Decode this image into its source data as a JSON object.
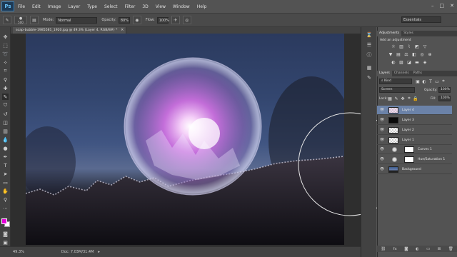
{
  "app": {
    "logo": "Ps",
    "menu": [
      "File",
      "Edit",
      "Image",
      "Layer",
      "Type",
      "Select",
      "Filter",
      "3D",
      "View",
      "Window",
      "Help"
    ],
    "window_controls": [
      "–",
      "□",
      "✕"
    ]
  },
  "options_bar": {
    "brush_size": "500",
    "mode_label": "Mode:",
    "mode_value": "Normal",
    "opacity_label": "Opacity:",
    "opacity_value": "80%",
    "flow_label": "Flow:",
    "flow_value": "100%",
    "workspace": "Essentials"
  },
  "document": {
    "tab_title": "soap-bubble-1985581_1920.jpg @ 49.3% (Layer 4, RGB/8#) *",
    "zoom": "49.3%",
    "doc_size": "Doc: 7.03M/31.4M"
  },
  "colors": {
    "foreground": "#e400d8",
    "background": "#ffffff",
    "selection": "#6b82a8"
  },
  "adjustments_panel": {
    "tabs": [
      "Adjustments",
      "Styles"
    ],
    "title": "Add an adjustment",
    "icons_row1": [
      "brightness-icon",
      "levels-icon",
      "curves-icon",
      "exposure-icon",
      "vibrance-icon"
    ],
    "icons_row2": [
      "vibrance2-icon",
      "hue-saturation-icon",
      "color-balance-icon",
      "black-white-icon",
      "photo-filter-icon",
      "channel-mixer-icon"
    ],
    "icons_row3": [
      "invert-icon",
      "posterize-icon",
      "threshold-icon",
      "gradient-map-icon",
      "selective-color-icon"
    ]
  },
  "layers_panel": {
    "tabs": [
      "Layers",
      "Channels",
      "Paths"
    ],
    "kind_label": "Kind",
    "blend_mode": "Screen",
    "opacity_label": "Opacity:",
    "opacity_value": "100%",
    "lock_label": "Lock:",
    "fill_label": "Fill:",
    "fill_value": "100%",
    "layers": [
      {
        "name": "Layer 4",
        "type": "pixel",
        "selected": true
      },
      {
        "name": "Layer 3",
        "type": "pixel",
        "selected": false
      },
      {
        "name": "Layer 2",
        "type": "pixel",
        "selected": false
      },
      {
        "name": "Layer 1",
        "type": "pixel",
        "selected": false
      },
      {
        "name": "Curves 1",
        "type": "adjustment",
        "selected": false
      },
      {
        "name": "Hue/Saturation 1",
        "type": "adjustment",
        "selected": false
      },
      {
        "name": "Background",
        "type": "image",
        "selected": false
      }
    ]
  }
}
